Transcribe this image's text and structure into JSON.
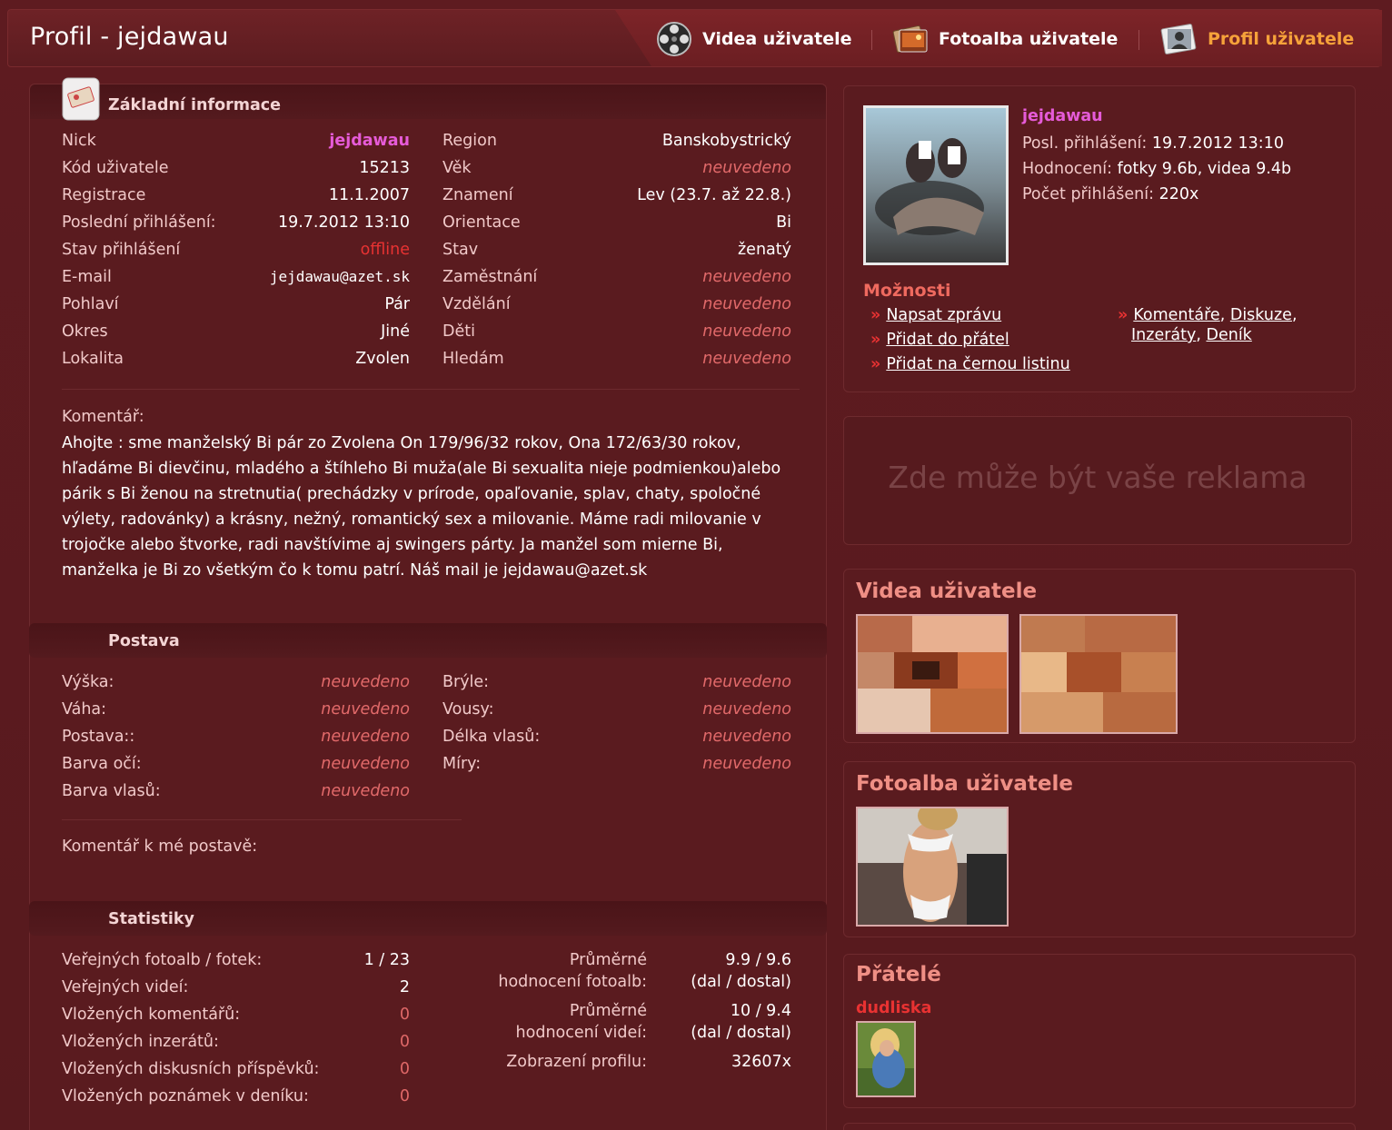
{
  "header": {
    "title": "Profil - jejdawau",
    "tabs": [
      {
        "label": "Videa uživatele",
        "icon": "film-reel-icon"
      },
      {
        "label": "Fotoalba uživatele",
        "icon": "photo-album-icon"
      },
      {
        "label": "Profil uživatele",
        "icon": "user-profile-icon"
      }
    ]
  },
  "basic": {
    "title": "Základní informace",
    "icon": "id-card-icon",
    "left": [
      {
        "label": "Nick",
        "value": "jejdawau"
      },
      {
        "label": "Kód uživatele",
        "value": "15213"
      },
      {
        "label": "Registrace",
        "value": "11.1.2007"
      },
      {
        "label": "Poslední přihlášení:",
        "value": "19.7.2012 13:10"
      },
      {
        "label": "Stav přihlášení",
        "value": "offline"
      },
      {
        "label": "E-mail",
        "value": "jejdawau@azet.sk"
      },
      {
        "label": "Pohlaví",
        "value": "Pár"
      },
      {
        "label": "Okres",
        "value": "Jiné"
      },
      {
        "label": "Lokalita",
        "value": "Zvolen"
      }
    ],
    "right": [
      {
        "label": "Region",
        "value": "Banskobystrický"
      },
      {
        "label": "Věk",
        "value": "neuvedeno"
      },
      {
        "label": "Znamení",
        "value": "Lev (23.7. až 22.8.)"
      },
      {
        "label": "Orientace",
        "value": "Bi"
      },
      {
        "label": "Stav",
        "value": "ženatý"
      },
      {
        "label": "Zaměstnání",
        "value": "neuvedeno"
      },
      {
        "label": "Vzdělání",
        "value": "neuvedeno"
      },
      {
        "label": "Děti",
        "value": "neuvedeno"
      },
      {
        "label": "Hledám",
        "value": "neuvedeno"
      }
    ],
    "comment_label": "Komentář:",
    "comment_lines": [
      "Ahojte : sme manželský Bi pár zo Zvolena On 179/96/32 rokov, Ona 172/63/30 rokov,",
      "hľadáme Bi dievčinu, mladého a štíhleho Bi muža(ale Bi sexualita nieje podmienkou)alebo",
      "párik s Bi ženou na stretnutia( prechádzky v prírode, opaľovanie, splav, chaty, spoločné",
      "výlety, radovánky) a krásny, nežný, romantický sex a milovanie. Máme radi milovanie v",
      "trojočke alebo štvorke, radi navštívime aj swingers párty. Ja manžel som mierne Bi,",
      "manželka je Bi zo všetkým čo k tomu patrí. Náš mail je jejdawau@azet.sk"
    ]
  },
  "figure": {
    "title": "Postava",
    "left": [
      {
        "label": "Výška:",
        "value": "neuvedeno"
      },
      {
        "label": "Váha:",
        "value": "neuvedeno"
      },
      {
        "label": "Postava::",
        "value": "neuvedeno"
      },
      {
        "label": "Barva očí:",
        "value": "neuvedeno"
      },
      {
        "label": "Barva vlasů:",
        "value": "neuvedeno"
      }
    ],
    "right": [
      {
        "label": "Brýle:",
        "value": "neuvedeno"
      },
      {
        "label": "Vousy:",
        "value": "neuvedeno"
      },
      {
        "label": "Délka vlasů:",
        "value": "neuvedeno"
      },
      {
        "label": "Míry:",
        "value": "neuvedeno"
      }
    ],
    "comment_label": "Komentář k mé postavě:"
  },
  "stats": {
    "title": "Statistiky",
    "left": [
      {
        "label": "Veřejných fotoalb / fotek:",
        "value": "1 / 23"
      },
      {
        "label": "Veřejných videí:",
        "value": "2"
      },
      {
        "label": "Vložených komentářů:",
        "value": "0"
      },
      {
        "label": "Vložených inzerátů:",
        "value": "0"
      },
      {
        "label": "Vložených diskusních příspěvků:",
        "value": "0"
      },
      {
        "label": "Vložených poznámek v deníku:",
        "value": "0"
      }
    ],
    "right": [
      {
        "label1": "Průměrné",
        "label2": "hodnocení fotoalb:",
        "value1": "9.9 / 9.6",
        "value2": "(dal / dostal)"
      },
      {
        "label1": "Průměrné",
        "label2": "hodnocení videí:",
        "value1": "10 / 9.4",
        "value2": "(dal / dostal)"
      },
      {
        "label1": "Zobrazení profilu:",
        "value1": "32607x"
      }
    ]
  },
  "user_card": {
    "nick": "jejdawau",
    "lines": [
      {
        "label": "Posl. přihlášení:",
        "value": "19.7.2012 13:10"
      },
      {
        "label": "Hodnocení:",
        "value": "fotky 9.6b, videa 9.4b"
      },
      {
        "label": "Počet přihlášení:",
        "value": "220x"
      }
    ],
    "options_title": "Možnosti",
    "options_left": [
      "Napsat zprávu",
      "Přidat do přátel",
      "Přidat na černou listinu"
    ],
    "options_right_1": [
      "Komentáře",
      "Diskuze"
    ],
    "options_right_2": [
      "Inzeráty",
      "Deník"
    ]
  },
  "ad": {
    "text": "Zde může být vaše reklama"
  },
  "videos": {
    "title": "Videa uživatele"
  },
  "albums": {
    "title": "Fotoalba uživatele"
  },
  "friends": {
    "title": "Přátelé",
    "friend_name": "dudliska"
  },
  "colors": {
    "background": "#5a1a1e",
    "accent_orange": "#f6a23a",
    "nick_pink": "#e65bd8",
    "offline_red": "#e83232",
    "section_salmon": "#ef8f85"
  }
}
